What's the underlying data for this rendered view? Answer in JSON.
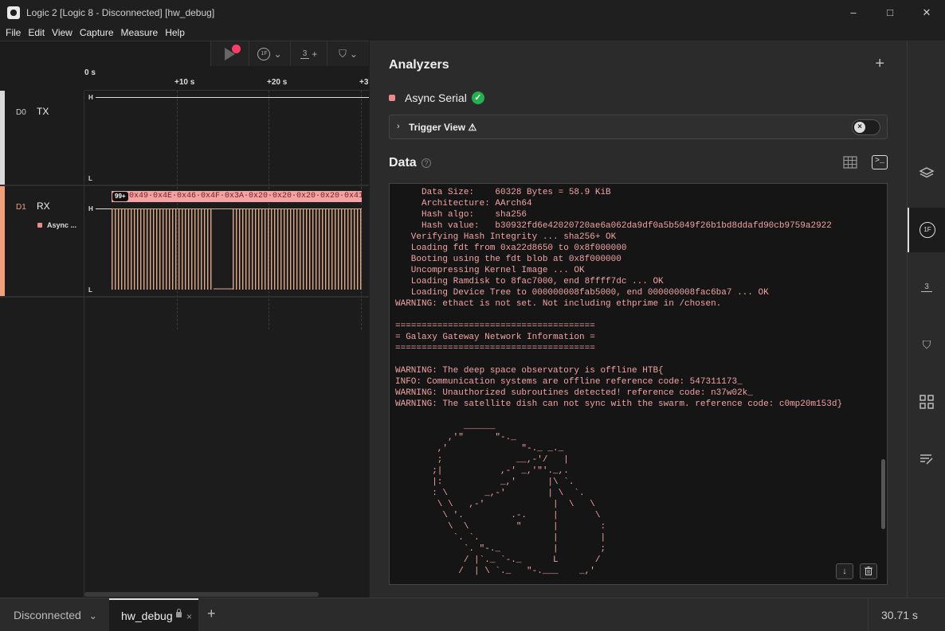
{
  "window": {
    "title": "Logic 2 [Logic 8 - Disconnected] [hw_debug]",
    "minimize": "–",
    "maximize": "□",
    "close": "✕"
  },
  "menu": [
    "File",
    "Edit",
    "View",
    "Capture",
    "Measure",
    "Help"
  ],
  "toolbar": {
    "trigger_label": "1F",
    "timing_label": "3",
    "timing_plus": "+"
  },
  "ruler": {
    "ticks": [
      "0 s",
      "+10 s",
      "+20 s",
      "+3"
    ]
  },
  "channels": [
    {
      "num": "D0",
      "name": "TX",
      "color": "#d9d9d9",
      "high": "H",
      "low": "L"
    },
    {
      "num": "D1",
      "name": "RX",
      "color": "#f0a07a",
      "high": "H",
      "low": "L",
      "analyzer": "Async ..."
    }
  ],
  "decode": {
    "badge": "99+",
    "text": "0x49·0x4E·0x46·0x4F·0x3A·0x20·0x20·0x20·0x20·0x41"
  },
  "analyzers": {
    "title": "Analyzers",
    "add": "+",
    "items": [
      {
        "name": "Async Serial",
        "status": "✓",
        "color": "#f08a8a"
      }
    ],
    "trigger_view": "Trigger View ⚠"
  },
  "data_panel": {
    "title": "Data",
    "help": "?",
    "terminal_lines": [
      "     Data Size:    60328 Bytes = 58.9 KiB",
      "     Architecture: AArch64",
      "     Hash algo:    sha256",
      "     Hash value:   b30932fd6e42020720ae6a062da9df0a5b5049f26b1bd8ddafd90cb9759a2922",
      "   Verifying Hash Integrity ... sha256+ OK",
      "   Loading fdt from 0xa22d8650 to 0x8f000000",
      "   Booting using the fdt blob at 0x8f000000",
      "   Uncompressing Kernel Image ... OK",
      "   Loading Ramdisk to 8fac7000, end 8ffff7dc ... OK",
      "   Loading Device Tree to 000000008fab5000, end 000000008fac6ba7 ... OK",
      "WARNING: ethact is not set. Not including ethprime in /chosen.",
      "",
      "======================================",
      "= Galaxy Gateway Network Information =",
      "======================================",
      "",
      "WARNING: The deep space observatory is offline HTB{",
      "INFO: Communication systems are offline reference code: 547311173_",
      "WARNING: Unauthorized subroutines detected! reference code: n37w02k_",
      "WARNING: The satellite dish can not sync with the swarm. reference code: c0mp20m153d}",
      "",
      "             ______",
      "          ,'\"      \"-._",
      "        ,'              \"-._ _._",
      "        ;              __,-'/   |",
      "       ;|           ,-' _,'\"'._,.",
      "       |:           _,'      |\\ `.",
      "       : \\       _,-'        | \\  `.",
      "        \\ \\   ,-'             |  \\   \\",
      "         \\ '.         .-.     |       \\",
      "          \\  \\         \"      |        :",
      "           `. `.              |        |",
      "             `. \"-._          |        ;",
      "             / |`._ `-._      L       /",
      "            /  | \\ `._   \"-.___    _,'"
    ],
    "scroll_down": "↓",
    "clear": "🗑"
  },
  "sidebar": [
    "layers-icon",
    "trigger-icon",
    "timing-icon",
    "marker-icon",
    "extensions-icon",
    "notes-icon"
  ],
  "status": {
    "connection": "Disconnected",
    "connection_chevron": "⌄",
    "tab": "hw_debug",
    "tab_lock": "🔒",
    "tab_close": "×",
    "add_tab": "+",
    "time": "30.71 s"
  }
}
